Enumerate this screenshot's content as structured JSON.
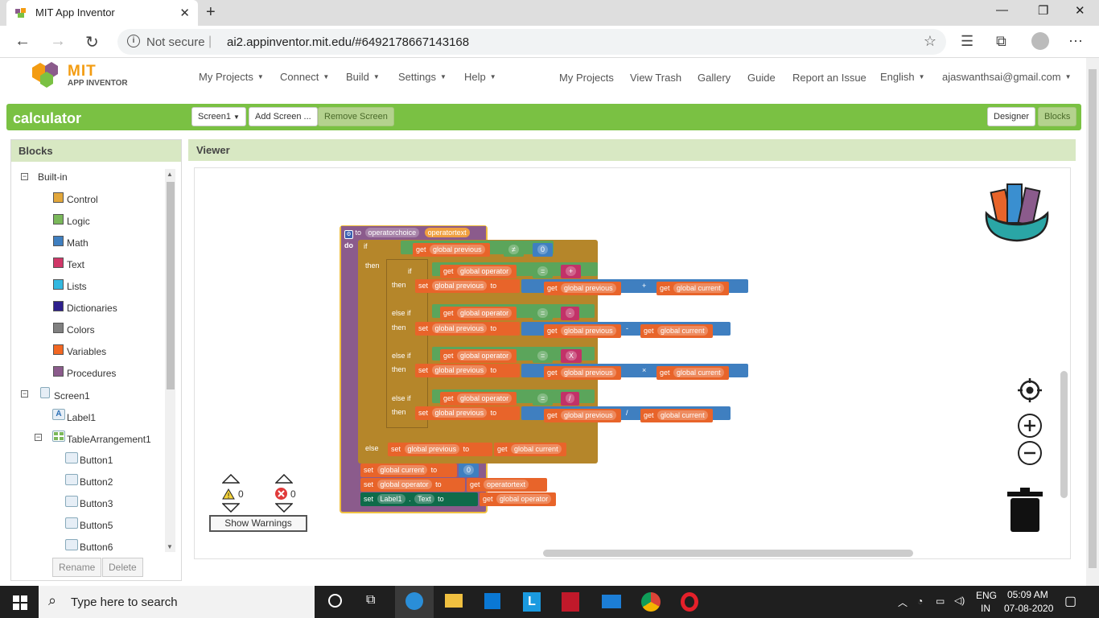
{
  "browser": {
    "tab_title": "MIT App Inventor",
    "tab_close": "✕",
    "new_tab": "+",
    "not_secure": "Not secure",
    "url": "ai2.appinventor.mit.edu/#6492178667143168",
    "window_minimize": "—",
    "window_restore": "❐",
    "window_close": "✕"
  },
  "app": {
    "logo_title": "MIT",
    "logo_subtitle": "APP INVENTOR",
    "menus": [
      "My Projects",
      "Connect",
      "Build",
      "Settings",
      "Help"
    ],
    "links": [
      "My Projects",
      "View Trash",
      "Gallery",
      "Guide",
      "Report an Issue",
      "English"
    ],
    "user_email": "ajaswanthsai@gmail.com"
  },
  "titlebar": {
    "project_name": "calculator",
    "screen_select": "Screen1",
    "add_screen": "Add Screen ...",
    "remove_screen": "Remove Screen",
    "designer": "Designer",
    "blocks": "Blocks"
  },
  "blocks_panel": {
    "header": "Blocks",
    "builtin_label": "Built-in",
    "builtin": [
      {
        "label": "Control",
        "color": "#e2a73b"
      },
      {
        "label": "Logic",
        "color": "#7ab85a"
      },
      {
        "label": "Math",
        "color": "#3f7fc0"
      },
      {
        "label": "Text",
        "color": "#d03768"
      },
      {
        "label": "Lists",
        "color": "#33b8e0"
      },
      {
        "label": "Dictionaries",
        "color": "#2d1f8c"
      },
      {
        "label": "Colors",
        "color": "#808080"
      },
      {
        "label": "Variables",
        "color": "#f26722"
      },
      {
        "label": "Procedures",
        "color": "#8b5b8c"
      }
    ],
    "screen_label": "Screen1",
    "label1": "Label1",
    "table_arrangement": "TableArrangement1",
    "buttons": [
      "Button1",
      "Button2",
      "Button3",
      "Button5",
      "Button6"
    ],
    "rename": "Rename",
    "delete": "Delete"
  },
  "viewer": {
    "header": "Viewer",
    "warnings_count": "0",
    "errors_count": "0",
    "show_warnings": "Show Warnings"
  },
  "code": {
    "to": "to",
    "proc_name": "operatorchoice",
    "param": "operatortext",
    "do": "do",
    "if": "if",
    "then": "then",
    "else_if": "else if",
    "else": "else",
    "get": "get",
    "set": "set",
    "to_kw": "to",
    "global_previous": "global previous",
    "global_current": "global current",
    "global_operator": "global operator",
    "neq": "≠",
    "eq": "=",
    "zero": "0",
    "plus_str": "+",
    "minus_str": "-",
    "x_str": "X",
    "div_str": "/",
    "plus_op": "+",
    "minus_op": "-",
    "times_op": "×",
    "div_op": "/",
    "get_param": "operatortext",
    "label1": "Label1",
    "dot": ".",
    "text_prop": "Text"
  },
  "taskbar": {
    "search_placeholder": "Type here to search",
    "lang_top": "ENG",
    "lang_bottom": "IN",
    "time": "05:09 AM",
    "date": "07-08-2020"
  }
}
